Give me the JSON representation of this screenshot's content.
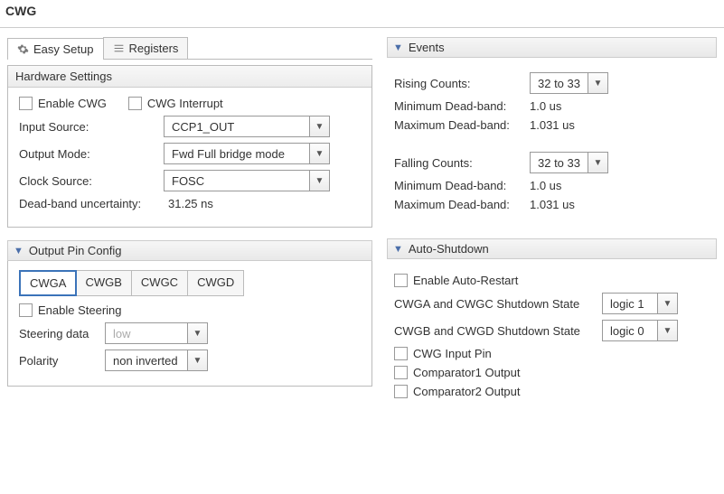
{
  "title": "CWG",
  "topTabs": {
    "easySetup": "Easy Setup",
    "registers": "Registers"
  },
  "hardware": {
    "title": "Hardware Settings",
    "enableCwg": "Enable CWG",
    "cwgInterrupt": "CWG Interrupt",
    "inputSourceLabel": "Input Source:",
    "inputSource": "CCP1_OUT",
    "outputModeLabel": "Output Mode:",
    "outputMode": "Fwd Full bridge mode",
    "clockSourceLabel": "Clock Source:",
    "clockSource": "FOSC",
    "deadbandUncLabel": "Dead-band uncertainty:",
    "deadbandUnc": "31.25 ns"
  },
  "outputPin": {
    "title": "Output Pin Config",
    "tabs": [
      "CWGA",
      "CWGB",
      "CWGC",
      "CWGD"
    ],
    "enableSteering": "Enable Steering",
    "steeringLabel": "Steering data",
    "steering": "low",
    "polarityLabel": "Polarity",
    "polarity": "non inverted"
  },
  "events": {
    "title": "Events",
    "risingLabel": "Rising Counts:",
    "rising": "32 to 33",
    "risingMinLabel": "Minimum Dead-band:",
    "risingMin": "1.0 us",
    "risingMaxLabel": "Maximum Dead-band:",
    "risingMax": "1.031 us",
    "fallingLabel": "Falling Counts:",
    "falling": "32 to 33",
    "fallingMinLabel": "Minimum Dead-band:",
    "fallingMin": "1.0 us",
    "fallingMaxLabel": "Maximum Dead-band:",
    "fallingMax": "1.031 us"
  },
  "autoShutdown": {
    "title": "Auto-Shutdown",
    "enableAutoRestart": "Enable Auto-Restart",
    "stateACLabel": "CWGA and CWGC Shutdown State",
    "stateAC": "logic 1",
    "stateBDLabel": "CWGB and CWGD Shutdown State",
    "stateBD": "logic 0",
    "cwgInputPin": "CWG Input Pin",
    "comp1": "Comparator1 Output",
    "comp2": "Comparator2 Output"
  }
}
